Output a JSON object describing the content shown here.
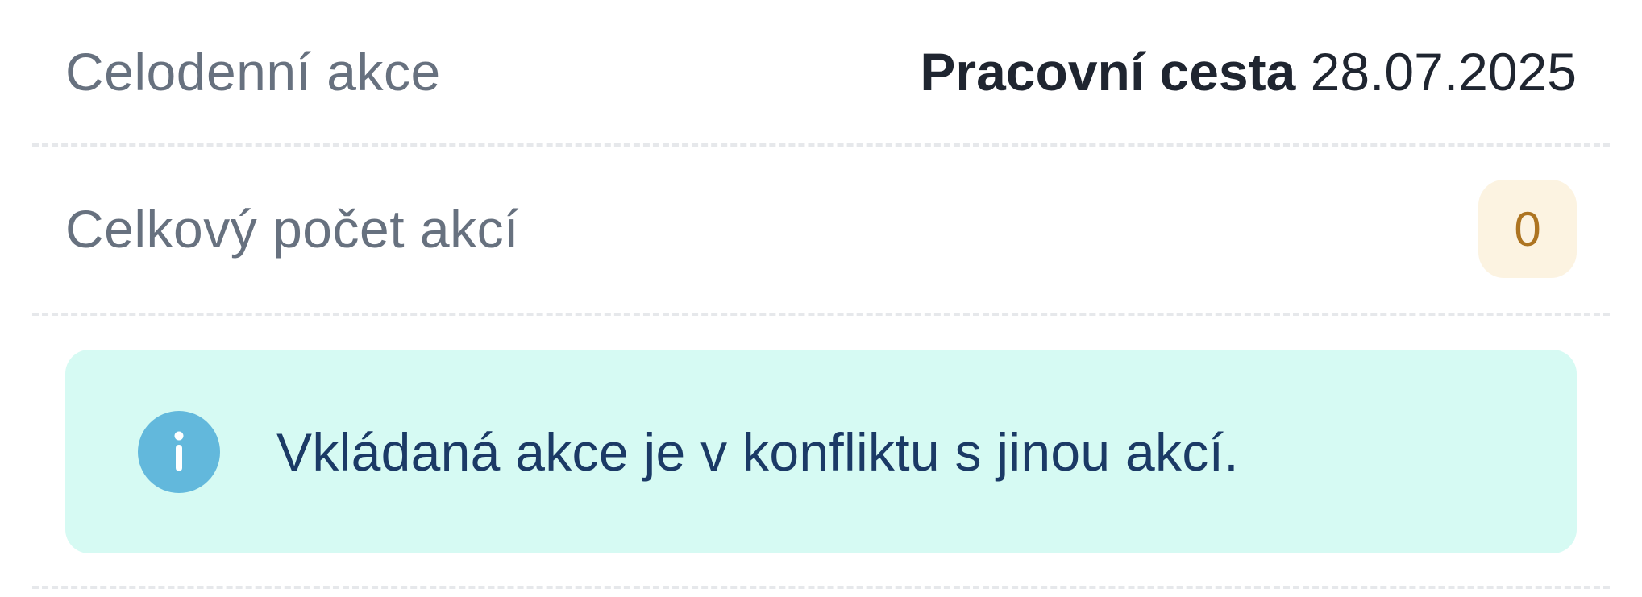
{
  "rows": [
    {
      "label": "Celodenní akce",
      "value_bold": "Pracovní cesta",
      "value_date": "28.07.2025"
    },
    {
      "label": "Celkový počet akcí",
      "badge": "0"
    }
  ],
  "alert": {
    "icon": "info-icon",
    "message": "Vkládaná akce je v konfliktu s jinou akcí."
  },
  "colors": {
    "label": "#67717f",
    "badge_bg": "#fcf3e1",
    "badge_text": "#ad7421",
    "alert_bg": "#d6faf3",
    "alert_text": "#1b3a66",
    "info_icon": "#62b8dc"
  }
}
